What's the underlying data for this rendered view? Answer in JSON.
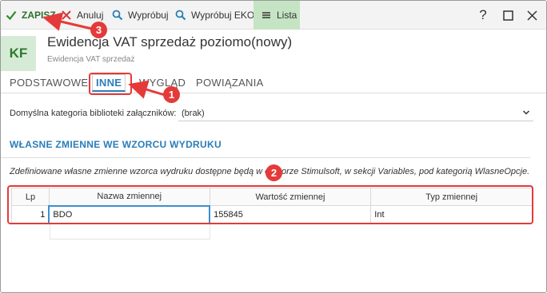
{
  "toolbar": {
    "save_label": "ZAPISZ",
    "cancel_label": "Anuluj",
    "try_label": "Wypróbuj",
    "try_eko_label": "Wypróbuj EKO",
    "list_label": "Lista"
  },
  "window_controls": {
    "help_label": "?"
  },
  "header": {
    "badge": "KF",
    "title": "Ewidencja VAT sprzedaż poziomo(nowy)",
    "subtitle": "Ewidencja VAT sprzedaż"
  },
  "tabs": [
    {
      "label": "PODSTAWOWE",
      "active": false
    },
    {
      "label": "INNE",
      "active": true
    },
    {
      "label": "WYGLĄD",
      "active": false
    },
    {
      "label": "POWIĄZANIA",
      "active": false
    }
  ],
  "attachment": {
    "label": "Domyślna kategoria biblioteki załączników:",
    "value": "(brak)"
  },
  "section": {
    "title": "WŁASNE ZMIENNE WE WZORCU WYDRUKU",
    "description": "Zdefiniowane własne zmienne wzorca wydruku dostępne będą w edytorze Stimulsoft, w sekcji Variables, pod kategorią WlasneOpcje."
  },
  "table": {
    "headers": [
      "Lp",
      "Nazwa zmiennej",
      "Wartość zmiennej",
      "Typ zmiennej"
    ],
    "rows": [
      {
        "lp": "1",
        "name": "BDO",
        "value": "155845",
        "type": "Int"
      }
    ]
  },
  "annotations": {
    "badges": [
      "1",
      "2",
      "3"
    ],
    "color": "#e53a3a"
  },
  "colors": {
    "accent": "#2a7db9",
    "brand_green": "#2e7a2e",
    "list_bg": "#c5e4c4"
  }
}
